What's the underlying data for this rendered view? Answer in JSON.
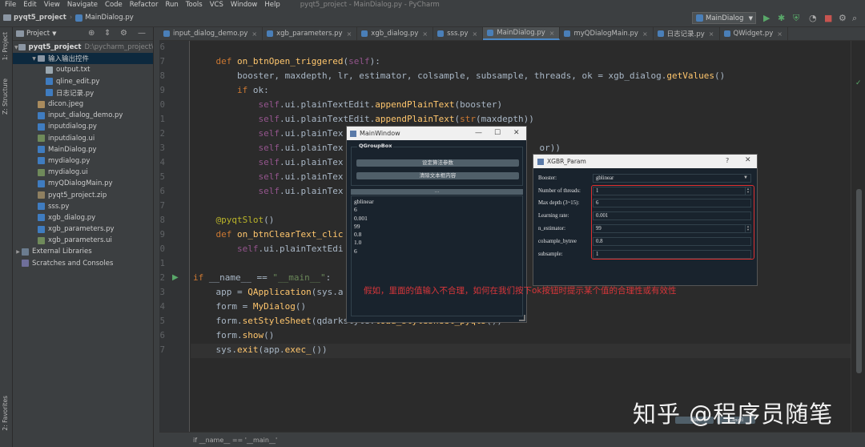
{
  "menubar": {
    "items": [
      "File",
      "Edit",
      "View",
      "Navigate",
      "Code",
      "Refactor",
      "Run",
      "Tools",
      "VCS",
      "Window",
      "Help"
    ],
    "title": "pyqt5_project - MainDialog.py - PyCharm"
  },
  "navbar": {
    "project": "pyqt5_project",
    "file": "MainDialog.py"
  },
  "run_config": {
    "label": "MainDialog"
  },
  "left_strip": {
    "project": "1: Project",
    "structure": "Z: Structure",
    "favorites": "2: Favorites"
  },
  "project_panel": {
    "title": "Project",
    "root": {
      "name": "pyqt5_project",
      "path": "D:\\pycharm_project\\py"
    },
    "tree": [
      {
        "label": "输入输出控件",
        "icon": "folder",
        "indent": 2,
        "expanded": true
      },
      {
        "label": "output.txt",
        "icon": "txt",
        "indent": 3
      },
      {
        "label": "qline_edit.py",
        "icon": "py",
        "indent": 3
      },
      {
        "label": "日志记录.py",
        "icon": "py",
        "indent": 3
      },
      {
        "label": "dicon.jpeg",
        "icon": "img",
        "indent": 2
      },
      {
        "label": "input_dialog_demo.py",
        "icon": "py",
        "indent": 2
      },
      {
        "label": "inputdialog.py",
        "icon": "py",
        "indent": 2
      },
      {
        "label": "inputdialog.ui",
        "icon": "ui",
        "indent": 2
      },
      {
        "label": "MainDialog.py",
        "icon": "py",
        "indent": 2
      },
      {
        "label": "mydialog.py",
        "icon": "py",
        "indent": 2
      },
      {
        "label": "mydialog.ui",
        "icon": "ui",
        "indent": 2
      },
      {
        "label": "myQDialogMain.py",
        "icon": "py",
        "indent": 2
      },
      {
        "label": "pyqt5_project.zip",
        "icon": "zip",
        "indent": 2
      },
      {
        "label": "sss.py",
        "icon": "py",
        "indent": 2
      },
      {
        "label": "xgb_dialog.py",
        "icon": "py",
        "indent": 2
      },
      {
        "label": "xgb_parameters.py",
        "icon": "py",
        "indent": 2
      },
      {
        "label": "xgb_parameters.ui",
        "icon": "ui",
        "indent": 2
      },
      {
        "label": "External Libraries",
        "icon": "lib",
        "indent": 0,
        "collapsed": true
      },
      {
        "label": "Scratches and Consoles",
        "icon": "scr",
        "indent": 0
      }
    ]
  },
  "tabs": [
    {
      "label": "input_dialog_demo.py"
    },
    {
      "label": "xgb_parameters.py"
    },
    {
      "label": "xgb_dialog.py"
    },
    {
      "label": "sss.py"
    },
    {
      "label": "MainDialog.py",
      "active": true
    },
    {
      "label": "myQDialogMain.py"
    },
    {
      "label": "日志记录.py"
    },
    {
      "label": "QWidget.py"
    }
  ],
  "editor": {
    "line_numbers": [
      "16",
      "17",
      "18",
      "19",
      "20",
      "21",
      "22",
      "23",
      "24",
      "25",
      "26",
      "27",
      "28",
      "29",
      "30",
      "31",
      "32",
      "33",
      "34",
      "35",
      "36",
      "37"
    ]
  },
  "status": {
    "breadcrumb": "if __name__ == '__main__'"
  },
  "main_window": {
    "title": "MainWindow",
    "group_title": "QGroupBox",
    "btn_set_params": "设定算法参数",
    "btn_clear": "清除文本框内容",
    "splitter_label": "...",
    "output_lines": [
      "gblinear",
      "6",
      "0.001",
      "99",
      "0.8",
      "1.0",
      "6"
    ]
  },
  "xgbr_dialog": {
    "title": "XGBR_Param",
    "help": "?",
    "booster_label": "Booster:",
    "booster_value": "gblinear",
    "fields": [
      {
        "label": "Number of threads:",
        "value": "1",
        "spin": true
      },
      {
        "label": "Max depth (3~15):",
        "value": "6",
        "spin": false
      },
      {
        "label": "Learning rate:",
        "value": "0.001",
        "spin": false
      },
      {
        "label": "n_estimator:",
        "value": "99",
        "spin": true
      },
      {
        "label": "colsample_bytree",
        "value": "0.8",
        "spin": false
      },
      {
        "label": "subsample:",
        "value": "1",
        "spin": false
      }
    ],
    "ok": "OK",
    "cancel": "Cancel"
  },
  "annotation": "假如，里面的值输入不合理，如何在我们按下ok按钮时提示某个值的合理性或有效性",
  "watermark": "知乎 @程序员随笔",
  "colors": {
    "accent": "#4a88c7",
    "annotation": "#d8363a",
    "keyword": "#cc7832",
    "function": "#ffc66d"
  }
}
